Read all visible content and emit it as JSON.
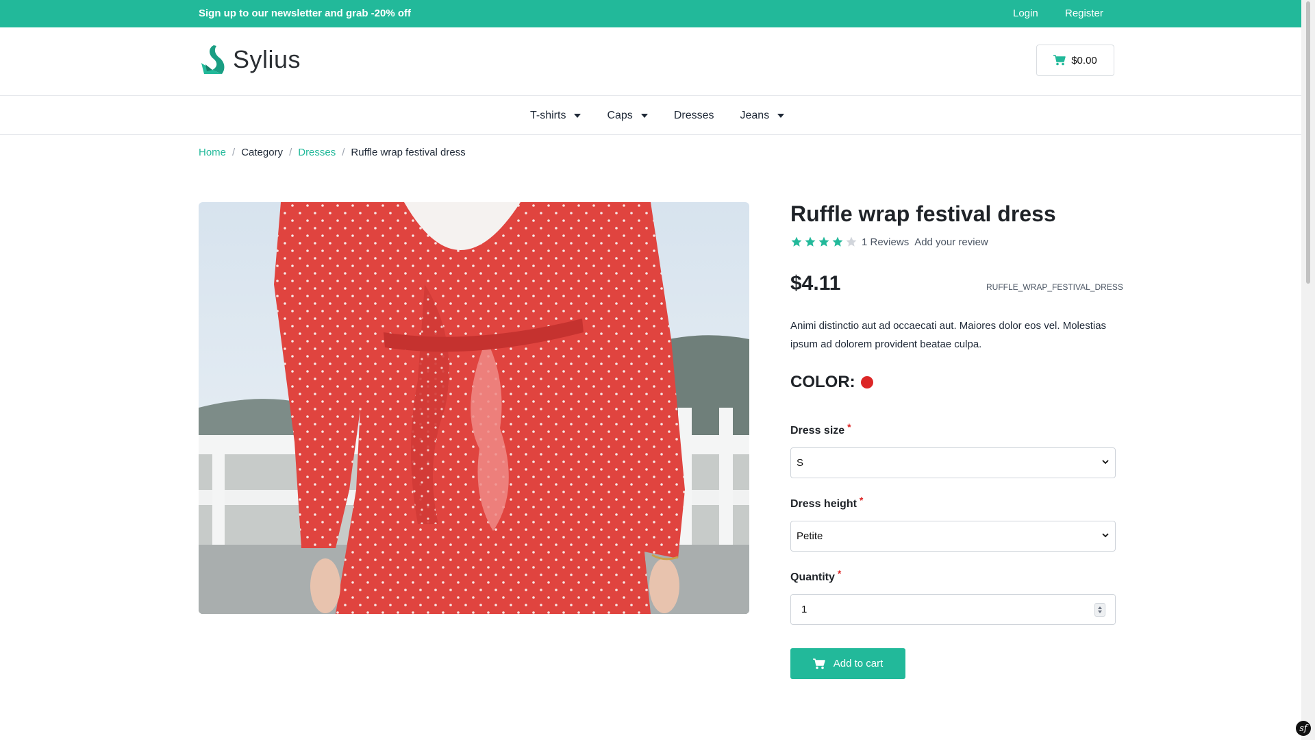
{
  "topbar": {
    "promo": "Sign up to our newsletter and grab -20% off",
    "login": "Login",
    "register": "Register",
    "color": "#22b99a"
  },
  "header": {
    "logo_text": "Sylius",
    "logo_icon": "sylius-swan-icon",
    "cart_total": "$0.00",
    "cart_icon": "cart-icon"
  },
  "nav": {
    "items": [
      {
        "label": "T-shirts",
        "has_dropdown": true
      },
      {
        "label": "Caps",
        "has_dropdown": true
      },
      {
        "label": "Dresses",
        "has_dropdown": false
      },
      {
        "label": "Jeans",
        "has_dropdown": true
      }
    ]
  },
  "breadcrumb": {
    "items": [
      "Home",
      "Category",
      "Dresses",
      "Ruffle wrap festival dress"
    ],
    "separator": "/"
  },
  "product": {
    "title": "Ruffle wrap festival dress",
    "rating": 4,
    "rating_max": 5,
    "reviews": "1 Reviews",
    "add_review": "Add your review",
    "price": "$4.11",
    "sku": "RUFFLE_WRAP_FESTIVAL_DRESS",
    "description": "Animi distinctio aut ad occaecati aut. Maiores dolor eos vel. Molestias ipsum ad dolorem provident beatae culpa.",
    "color_label": "COLOR:",
    "color_value": "#dc2626",
    "image_icon": "red-polka-dot-dress-photo"
  },
  "form": {
    "dress_size_label": "Dress size",
    "dress_size_value": "S",
    "dress_height_label": "Dress height",
    "dress_height_value": "Petite",
    "quantity_label": "Quantity",
    "quantity_value": "1",
    "required_mark": "*",
    "add_to_cart": "Add to cart"
  },
  "accent_color": "#22b99a",
  "toolbar_icon": "symfony-icon",
  "toolbar_glyph": "sf"
}
